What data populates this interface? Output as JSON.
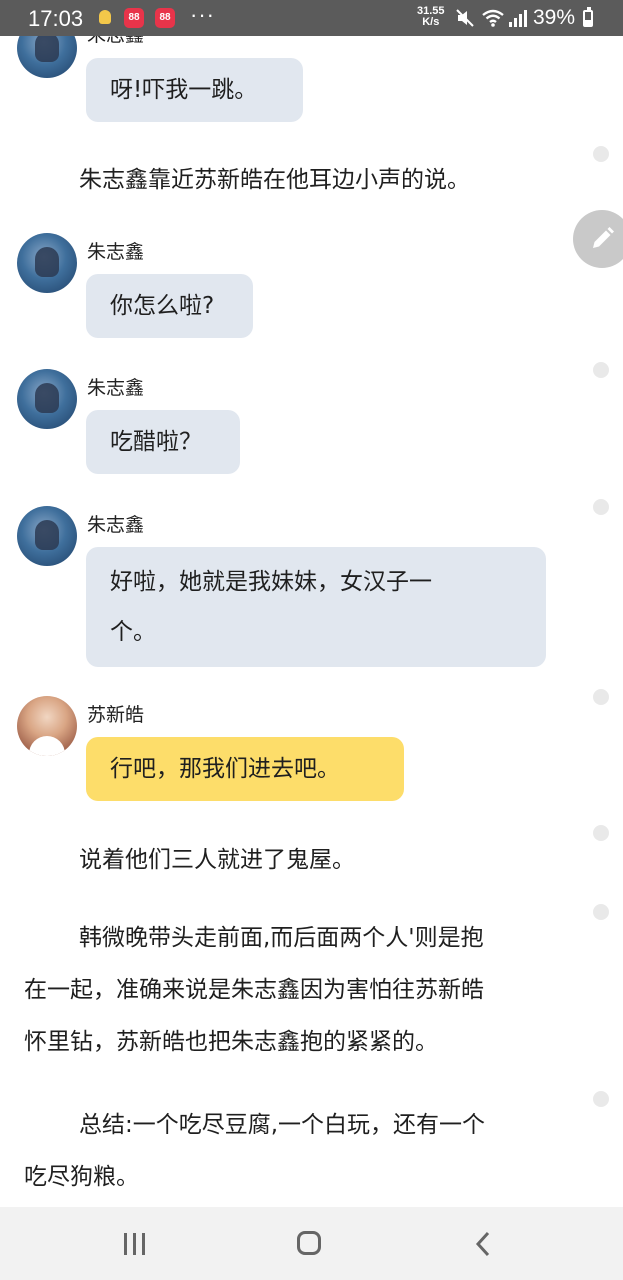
{
  "status_bar": {
    "time": "17:03",
    "app_badge": "88",
    "more": "···",
    "net_speed_value": "31.55",
    "net_speed_unit": "K/s",
    "battery_text": "39%",
    "battery_level": 0.39
  },
  "messages": [
    {
      "type": "chat",
      "speaker": "朱志鑫",
      "avatar": "zhu",
      "text": "呀!吓我一跳。"
    },
    {
      "type": "narration",
      "text": "朱志鑫靠近苏新皓在他耳边小声的说。"
    },
    {
      "type": "chat",
      "speaker": "朱志鑫",
      "avatar": "zhu",
      "text": "你怎么啦?"
    },
    {
      "type": "chat",
      "speaker": "朱志鑫",
      "avatar": "zhu",
      "text": "吃醋啦？"
    },
    {
      "type": "chat",
      "speaker": "朱志鑫",
      "avatar": "zhu",
      "text_line1": "好啦，她就是我妹妹，女汉子一",
      "text_line2": "个。"
    },
    {
      "type": "chat",
      "speaker": "苏新皓",
      "avatar": "su",
      "text": "行吧，那我们进去吧。"
    },
    {
      "type": "narration",
      "text": "说着他们三人就进了鬼屋。"
    },
    {
      "type": "narration",
      "line1": "韩微晚带头走前面,而后面两个人'则是抱",
      "line2": "在一起，准确来说是朱志鑫因为害怕往苏新皓",
      "line3": "怀里钻，苏新皓也把朱志鑫抱的紧紧的。"
    },
    {
      "type": "narration",
      "line1": "总结:一个吃尽豆腐,一个白玩，还有一个",
      "line2": "吃尽狗粮。"
    }
  ],
  "icons": {
    "edit": "pencil-icon",
    "nav_recent": "recent-apps-icon",
    "nav_home": "home-icon",
    "nav_back": "back-icon"
  },
  "colors": {
    "status_bar": "#5b5b5b",
    "bubble_other": "#e1e7ef",
    "bubble_self": "#fddd6a",
    "nav_bar": "#f2f2f2"
  }
}
